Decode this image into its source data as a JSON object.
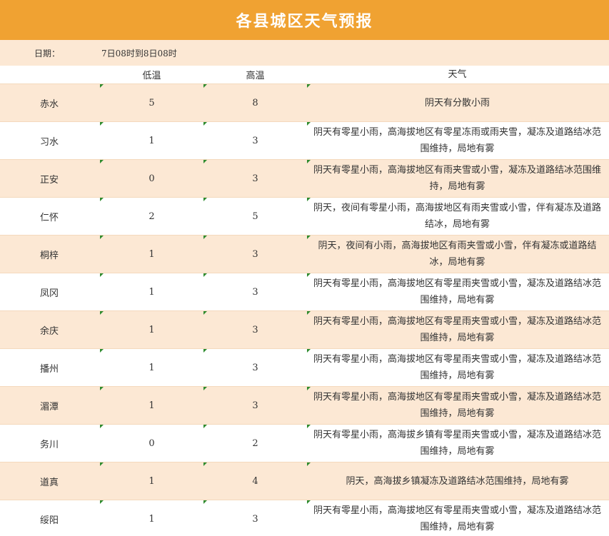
{
  "title": "各县城区天气预报",
  "date_label": "日期：",
  "date_value": "7日08时到8日08时",
  "headers": {
    "low": "低温",
    "high": "高温",
    "weather": "天气"
  },
  "colors": {
    "title_bg": "#f0a232",
    "band": "#fce8d4",
    "marker": "#2e8b2e"
  },
  "rows": [
    {
      "county": "赤水",
      "low": "5",
      "high": "8",
      "weather": "阴天有分散小雨"
    },
    {
      "county": "习水",
      "low": "1",
      "high": "3",
      "weather": "阴天有零星小雨，高海拔地区有零星冻雨或雨夹雪，凝冻及道路结冰范围维持，局地有雾"
    },
    {
      "county": "正安",
      "low": "0",
      "high": "3",
      "weather": "阴天有零星小雨，高海拔地区有雨夹雪或小雪，凝冻及道路结冰范围维持，局地有雾"
    },
    {
      "county": "仁怀",
      "low": "2",
      "high": "5",
      "weather": "阴天，夜间有零星小雨，高海拔地区有雨夹雪或小雪，伴有凝冻及道路结冰，局地有雾"
    },
    {
      "county": "桐梓",
      "low": "1",
      "high": "3",
      "weather": "阴天，夜间有小雨，高海拔地区有雨夹雪或小雪，伴有凝冻或道路结冰，局地有雾"
    },
    {
      "county": "凤冈",
      "low": "1",
      "high": "3",
      "weather": "阴天有零星小雨，高海拔地区有零星雨夹雪或小雪，凝冻及道路结冰范围维持，局地有雾"
    },
    {
      "county": "余庆",
      "low": "1",
      "high": "3",
      "weather": "阴天有零星小雨，高海拔地区有零星雨夹雪或小雪，凝冻及道路结冰范围维持，局地有雾"
    },
    {
      "county": "播州",
      "low": "1",
      "high": "3",
      "weather": "阴天有零星小雨，高海拔地区有零星雨夹雪或小雪，凝冻及道路结冰范围维持，局地有雾"
    },
    {
      "county": "湄潭",
      "low": "1",
      "high": "3",
      "weather": "阴天有零星小雨，高海拔地区有零星雨夹雪或小雪，凝冻及道路结冰范围维持，局地有雾"
    },
    {
      "county": "务川",
      "low": "0",
      "high": "2",
      "weather": "阴天有零星小雨，高海拔乡镇有零星雨夹雪或小雪，凝冻及道路结冰范围维持，局地有雾"
    },
    {
      "county": "道真",
      "low": "1",
      "high": "4",
      "weather": "阴天，高海拔乡镇凝冻及道路结冰范围维持，局地有雾"
    },
    {
      "county": "绥阳",
      "low": "1",
      "high": "3",
      "weather": "阴天有零星小雨，高海拔地区有零星雨夹雪或小雪，凝冻及道路结冰范围维持，局地有雾"
    }
  ]
}
